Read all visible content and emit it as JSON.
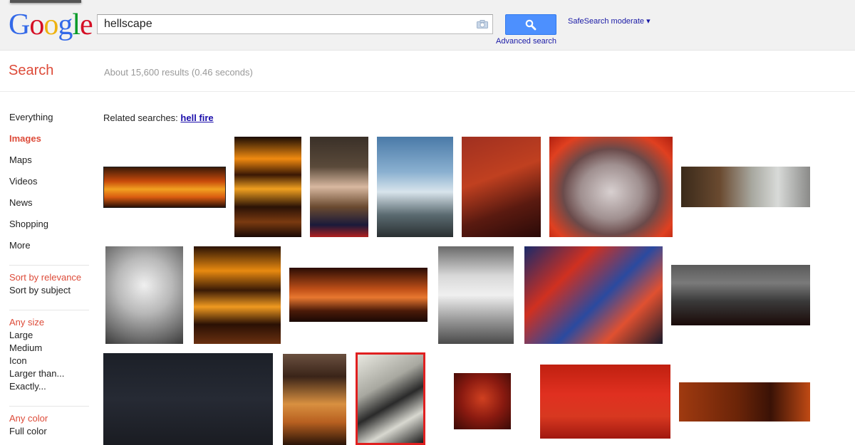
{
  "logo": {
    "letters": [
      "G",
      "o",
      "o",
      "g",
      "l",
      "e"
    ],
    "colors": [
      "#3369e8",
      "#d50f25",
      "#eeb211",
      "#3369e8",
      "#009925",
      "#d50f25"
    ]
  },
  "search": {
    "query": "hellscape",
    "button_icon": "magnifier-icon",
    "camera_icon": "camera-icon"
  },
  "header": {
    "advanced_search": "Advanced search",
    "safesearch": "SafeSearch moderate ▾"
  },
  "subheader": {
    "title": "Search",
    "stats": "About 15,600 results (0.46 seconds)"
  },
  "sidebar": {
    "items": [
      {
        "label": "Everything",
        "active": false
      },
      {
        "label": "Images",
        "active": true
      },
      {
        "label": "Maps",
        "active": false
      },
      {
        "label": "Videos",
        "active": false
      },
      {
        "label": "News",
        "active": false
      },
      {
        "label": "Shopping",
        "active": false
      },
      {
        "label": "More",
        "active": false
      }
    ],
    "sort": {
      "selected": "Sort by relevance",
      "other": "Sort by subject"
    },
    "size": {
      "selected": "Any size",
      "options": [
        "Large",
        "Medium",
        "Icon",
        "Larger than...",
        "Exactly..."
      ]
    },
    "color": {
      "selected": "Any color",
      "options": [
        "Full color"
      ]
    }
  },
  "related": {
    "prefix": "Related searches:",
    "link": "hell fire"
  },
  "accent_colors": {
    "red": "#dd4b39",
    "link": "#1a0dab",
    "button": "#4d90fe"
  }
}
